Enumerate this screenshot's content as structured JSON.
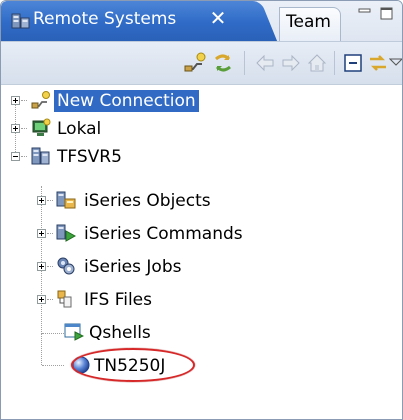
{
  "view": {
    "tabs": [
      {
        "label": "Remote Systems",
        "icon": "remote-systems-icon",
        "active": true
      },
      {
        "label": "Team",
        "active": false
      }
    ],
    "close_glyph": "✕"
  },
  "toolbar": {
    "buttons": [
      "new-connection-icon",
      "refresh-icon",
      "back-icon",
      "forward-icon",
      "home-icon",
      "collapse-all-icon",
      "link-with-editor-icon",
      "view-menu-icon"
    ]
  },
  "tree": {
    "nodes": [
      {
        "label": "New Connection",
        "icon": "new-connection-icon",
        "selected": true
      },
      {
        "label": "Lokal",
        "icon": "local-system-icon"
      },
      {
        "label": "TFSVR5",
        "icon": "server-icon",
        "expanded": true
      },
      {
        "label": "iSeries Objects",
        "icon": "iseries-objects-icon"
      },
      {
        "label": "iSeries Commands",
        "icon": "iseries-commands-icon"
      },
      {
        "label": "iSeries Jobs",
        "icon": "iseries-jobs-icon"
      },
      {
        "label": "IFS Files",
        "icon": "ifs-files-icon"
      },
      {
        "label": "Qshells",
        "icon": "qshells-icon"
      },
      {
        "label": "TN5250J",
        "icon": "tn5250j-icon",
        "highlighted": true
      }
    ]
  },
  "colors": {
    "active_tab": "#2f6bc7",
    "selection": "#316ac5",
    "highlight_ring": "#d62828"
  }
}
